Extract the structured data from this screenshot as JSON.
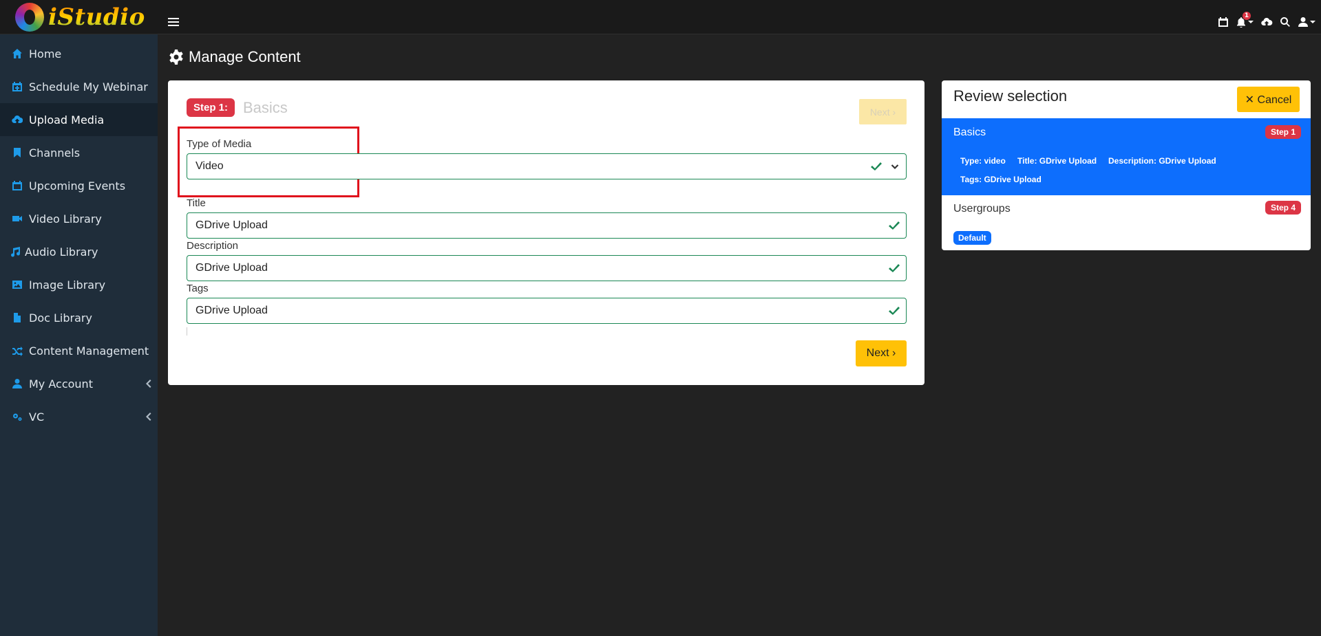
{
  "brand": {
    "text": "iStudio"
  },
  "sidebar": {
    "items": [
      {
        "label": "Home",
        "icon": "home-icon"
      },
      {
        "label": "Schedule My Webinar",
        "icon": "calendar-plus-icon"
      },
      {
        "label": "Upload Media",
        "icon": "cloud-upload-icon",
        "active": true
      },
      {
        "label": "Channels",
        "icon": "bookmark-icon"
      },
      {
        "label": "Upcoming Events",
        "icon": "calendar-icon"
      },
      {
        "label": "Video Library",
        "icon": "video-camera-icon"
      },
      {
        "label": "Audio Library",
        "icon": "music-note-icon"
      },
      {
        "label": "Image Library",
        "icon": "image-icon"
      },
      {
        "label": "Doc Library",
        "icon": "document-icon"
      },
      {
        "label": "Content Management",
        "icon": "shuffle-icon"
      },
      {
        "label": "My Account",
        "icon": "user-icon",
        "expandable": true
      },
      {
        "label": "VC",
        "icon": "gears-icon",
        "expandable": true
      }
    ]
  },
  "topbar": {
    "notification_count": "1",
    "icons": [
      "menu-icon",
      "calendar-icon",
      "bell-icon",
      "cloud-upload-icon",
      "search-icon",
      "user-icon"
    ]
  },
  "page": {
    "title": "Manage Content"
  },
  "wizard": {
    "step_badge": "Step 1:",
    "step_title": "Basics",
    "next_top_label": "Next",
    "next_label": "Next",
    "fields": {
      "media_type": {
        "label": "Type of Media",
        "value": "Video"
      },
      "title": {
        "label": "Title",
        "value": "GDrive Upload"
      },
      "description": {
        "label": "Description",
        "value": "GDrive Upload"
      },
      "tags": {
        "label": "Tags",
        "value": "GDrive Upload"
      }
    }
  },
  "review": {
    "title": "Review selection",
    "cancel_label": "Cancel",
    "basics": {
      "label": "Basics",
      "step": "Step 1",
      "tags": [
        "Type: video",
        "Title: GDrive Upload",
        "Description: GDrive Upload",
        "Tags: GDrive Upload"
      ]
    },
    "usergroups": {
      "label": "Usergroups",
      "step": "Step 4",
      "badge": "Default"
    }
  },
  "colors": {
    "accent_blue": "#0d6efd",
    "danger": "#dc3545",
    "warning": "#ffc107",
    "success": "#198754",
    "icon_blue": "#1e9be9"
  }
}
